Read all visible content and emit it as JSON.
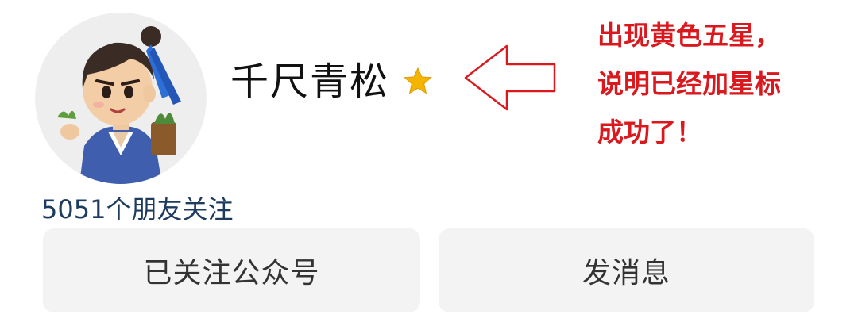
{
  "profile": {
    "name": "千尺青松",
    "star_color": "#f5b400",
    "followers_text": "5051个朋友关注"
  },
  "annotation": {
    "color": "#d9191e",
    "lines": [
      "出现黄色五星，",
      "说明已经加星标",
      "成功了！"
    ]
  },
  "buttons": {
    "follow_label": "已关注公众号",
    "message_label": "发消息"
  }
}
